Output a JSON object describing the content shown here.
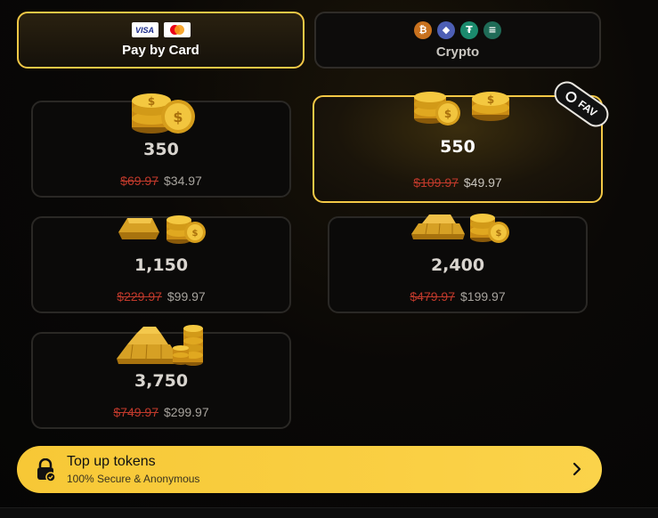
{
  "payment_tabs": {
    "card": {
      "label": "Pay by Card",
      "icons": [
        "visa-icon",
        "mastercard-icon"
      ],
      "visa_text": "VISA"
    },
    "crypto": {
      "label": "Crypto",
      "icons": [
        "bitcoin-icon",
        "ethereum-icon",
        "tether-icon",
        "solana-icon"
      ]
    }
  },
  "packs": [
    {
      "amount": "350",
      "old_price": "$69.97",
      "new_price": "$34.97",
      "selected": false,
      "art": "coin-stack-icon"
    },
    {
      "amount": "550",
      "old_price": "$109.97",
      "new_price": "$49.97",
      "selected": true,
      "badge": "FAV",
      "art": "coin-stacks-icon"
    },
    {
      "amount": "1,150",
      "old_price": "$229.97",
      "new_price": "$99.97",
      "selected": false,
      "art": "gold-bar-coins-icon"
    },
    {
      "amount": "2,400",
      "old_price": "$479.97",
      "new_price": "$199.97",
      "selected": false,
      "art": "gold-bars-coins-icon"
    },
    {
      "amount": "3,750",
      "old_price": "$749.97",
      "new_price": "$299.97",
      "selected": false,
      "art": "gold-pile-icon"
    }
  ],
  "cta": {
    "title": "Top up tokens",
    "subtitle": "100% Secure & Anonymous",
    "icon": "lock-icon",
    "arrow": "chevron-right-icon"
  },
  "colors": {
    "accent": "#f3c846",
    "old_price": "#c0392b",
    "background": "#070605"
  }
}
